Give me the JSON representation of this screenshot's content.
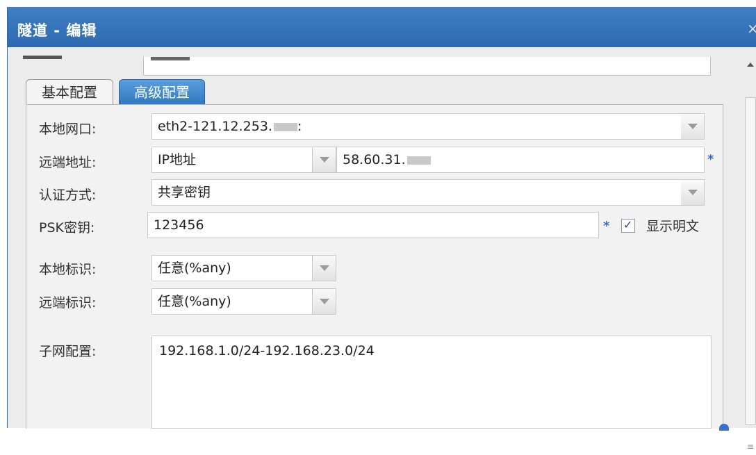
{
  "window": {
    "title": "隧道 - 编辑",
    "close_glyph": "×"
  },
  "tabs": [
    {
      "label": "基本配置",
      "active": false
    },
    {
      "label": "高级配置",
      "active": true
    }
  ],
  "form": {
    "local_interface": {
      "label": "本地网口:",
      "value": "eth2-121.12.253.",
      "value_suffix": ":"
    },
    "remote_address": {
      "label": "远端地址:",
      "type_value": "IP地址",
      "value": "58.60.31."
    },
    "auth_method": {
      "label": "认证方式:",
      "value": "共享密钥"
    },
    "psk": {
      "label": "PSK密钥:",
      "value": "123456",
      "show_plaintext_label": "显示明文",
      "show_plaintext_checked": true
    },
    "local_id": {
      "label": "本地标识:",
      "value": "任意(%any)"
    },
    "remote_id": {
      "label": "远端标识:",
      "value": "任意(%any)"
    },
    "subnet": {
      "label": "子网配置:",
      "value": "192.168.1.0/24-192.168.23.0/24"
    },
    "required_mark": "*"
  },
  "colors": {
    "titlebar": "#2e6ab0",
    "active_tab": "#2f78c0",
    "required_mark": "#3a6fd0"
  },
  "icons": [
    "close-icon",
    "dropdown-arrow-icon",
    "checkbox-checked-icon",
    "scroll-up-icon"
  ]
}
